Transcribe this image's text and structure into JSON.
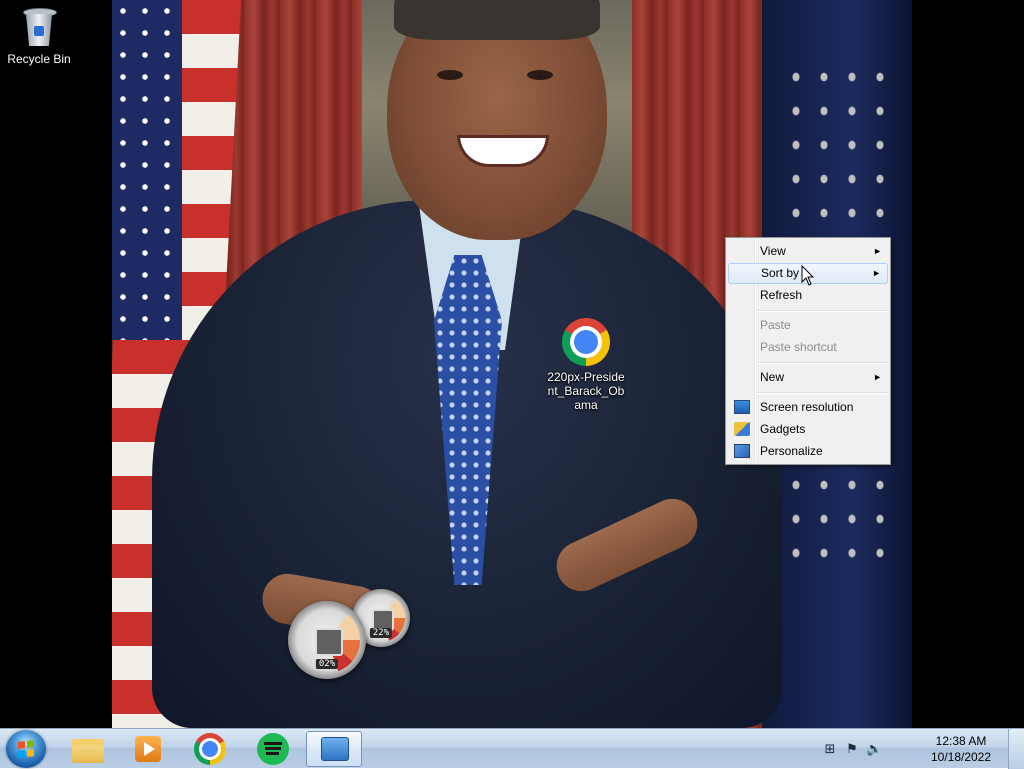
{
  "desktop": {
    "icons": [
      {
        "label": "Recycle Bin",
        "icon": "recycle-bin-icon"
      },
      {
        "label": "220px-President_Barack_Obama",
        "icon": "chrome-icon"
      }
    ],
    "file_label_lines": [
      "220px-Preside",
      "nt_Barack_Ob",
      "ama"
    ]
  },
  "gadgets": {
    "cpu_meter_readout": "02%",
    "memory_meter_readout": "22%"
  },
  "context_menu": {
    "items": [
      {
        "label": "View",
        "has_submenu": true,
        "enabled": true
      },
      {
        "label": "Sort by",
        "has_submenu": true,
        "enabled": true,
        "highlighted": true
      },
      {
        "label": "Refresh",
        "has_submenu": false,
        "enabled": true
      },
      {
        "label": "Paste",
        "has_submenu": false,
        "enabled": false
      },
      {
        "label": "Paste shortcut",
        "has_submenu": false,
        "enabled": false
      },
      {
        "label": "New",
        "has_submenu": true,
        "enabled": true
      },
      {
        "label": "Screen resolution",
        "has_submenu": false,
        "enabled": true,
        "icon": "monitor-icon"
      },
      {
        "label": "Gadgets",
        "has_submenu": false,
        "enabled": true,
        "icon": "gadgets-icon"
      },
      {
        "label": "Personalize",
        "has_submenu": false,
        "enabled": true,
        "icon": "personalize-icon"
      }
    ],
    "submenu_arrow": "►"
  },
  "taskbar": {
    "start_icon": "windows-logo-icon",
    "pinned": [
      {
        "name": "Windows Explorer",
        "icon": "folder-icon"
      },
      {
        "name": "Windows Media Player",
        "icon": "media-player-icon"
      },
      {
        "name": "Google Chrome",
        "icon": "chrome-icon"
      },
      {
        "name": "Spotify",
        "icon": "spotify-icon"
      },
      {
        "name": "Desktop Gadget Gallery",
        "icon": "gadget-gallery-icon",
        "active": true
      }
    ],
    "tray_icons": [
      "network-icon",
      "action-center-flag-icon",
      "volume-icon"
    ],
    "clock": {
      "time": "12:38 AM",
      "date": "10/18/2022"
    }
  },
  "colors": {
    "taskbar": "#c1d4ea",
    "menu_background": "#f0f0f0",
    "menu_highlight": "#dfeaf9"
  }
}
